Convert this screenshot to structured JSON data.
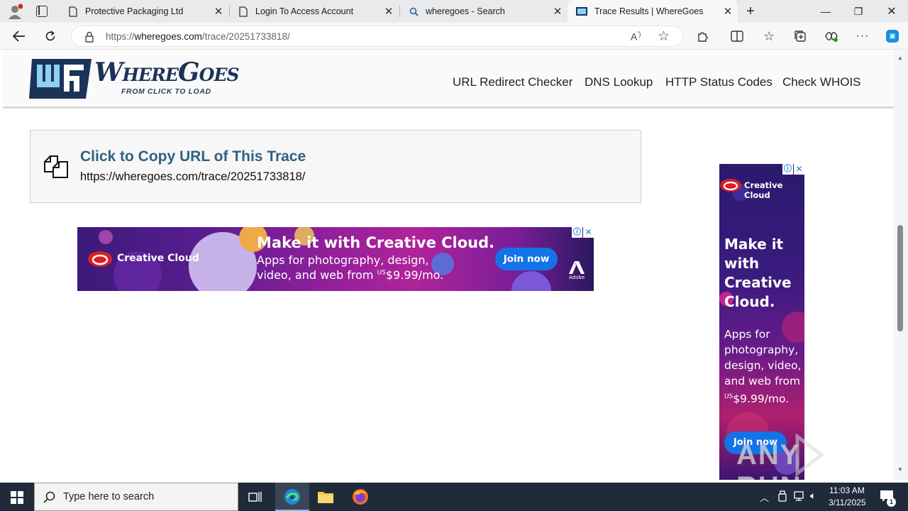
{
  "browser": {
    "tabs": [
      {
        "title": "Protective Packaging Ltd",
        "icon": "page-icon"
      },
      {
        "title": "Login To Access Account",
        "icon": "page-icon"
      },
      {
        "title": "wheregoes - Search",
        "icon": "search-icon"
      },
      {
        "title": "Trace Results | WhereGoes",
        "icon": "wheregoes-favicon",
        "active": true
      }
    ],
    "url_prefix": "https://",
    "url_domain": "wheregoes.com",
    "url_path": "/trace/20251733818/"
  },
  "site": {
    "logo_name": "WhereGoes",
    "logo_tagline": "FROM CLICK TO LOAD",
    "nav": [
      "URL Redirect Checker",
      "DNS Lookup",
      "HTTP Status Codes",
      "Check WHOIS"
    ],
    "copy_title": "Click to Copy URL of This Trace",
    "copy_url": "https://wheregoes.com/trace/20251733818/"
  },
  "banner_ad": {
    "brand": "Creative Cloud",
    "headline": "Make it with Creative Cloud.",
    "body_line1": "Apps for photography, design,",
    "body_line2": "video, and web from",
    "price_prefix": "US",
    "price": "$9.99/mo.",
    "cta": "Join now",
    "adobe_label": "Adobe"
  },
  "sky_ad": {
    "brand": "Creative Cloud",
    "headline_lines": [
      "Make it",
      "with",
      "Creative",
      "Cloud."
    ],
    "body_lines": [
      "Apps for",
      "photography,",
      "design, video,",
      "and web from"
    ],
    "price_prefix": "US",
    "price": "$9.99/mo.",
    "cta": "Join now"
  },
  "watermark": "ANY RUN",
  "taskbar": {
    "search_placeholder": "Type here to search",
    "time": "11:03 AM",
    "date": "3/11/2025",
    "notification_count": "1"
  },
  "colors": {
    "accent_blue": "#2f6282",
    "logo_navy": "#1b3358",
    "logo_light": "#8fd0f5",
    "cta_blue": "#1473e6"
  }
}
